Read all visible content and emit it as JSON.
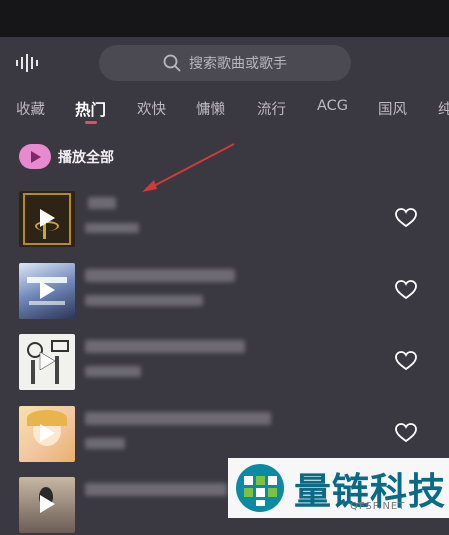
{
  "search": {
    "placeholder": "搜索歌曲或歌手"
  },
  "tabs": [
    {
      "label": "收藏"
    },
    {
      "label": "热门"
    },
    {
      "label": "欢快"
    },
    {
      "label": "慵懒"
    },
    {
      "label": "流行"
    },
    {
      "label": "ACG"
    },
    {
      "label": "国风"
    },
    {
      "label": "纯"
    }
  ],
  "active_tab": "热门",
  "play_all": {
    "label": "播放全部"
  },
  "songs": [
    {
      "title": "",
      "artist": "",
      "favorited": false
    },
    {
      "title": "",
      "artist": "",
      "favorited": false
    },
    {
      "title": "",
      "artist": "",
      "favorited": false
    },
    {
      "title": "",
      "artist": "",
      "favorited": false
    },
    {
      "title": "",
      "artist": "",
      "favorited": false
    }
  ],
  "colors": {
    "background": "#3a3840",
    "accent": "#e84a6a",
    "play_all_button": "#e88ad0"
  },
  "watermark": {
    "brand": "量链科技",
    "domain": "QFSP.NET"
  }
}
